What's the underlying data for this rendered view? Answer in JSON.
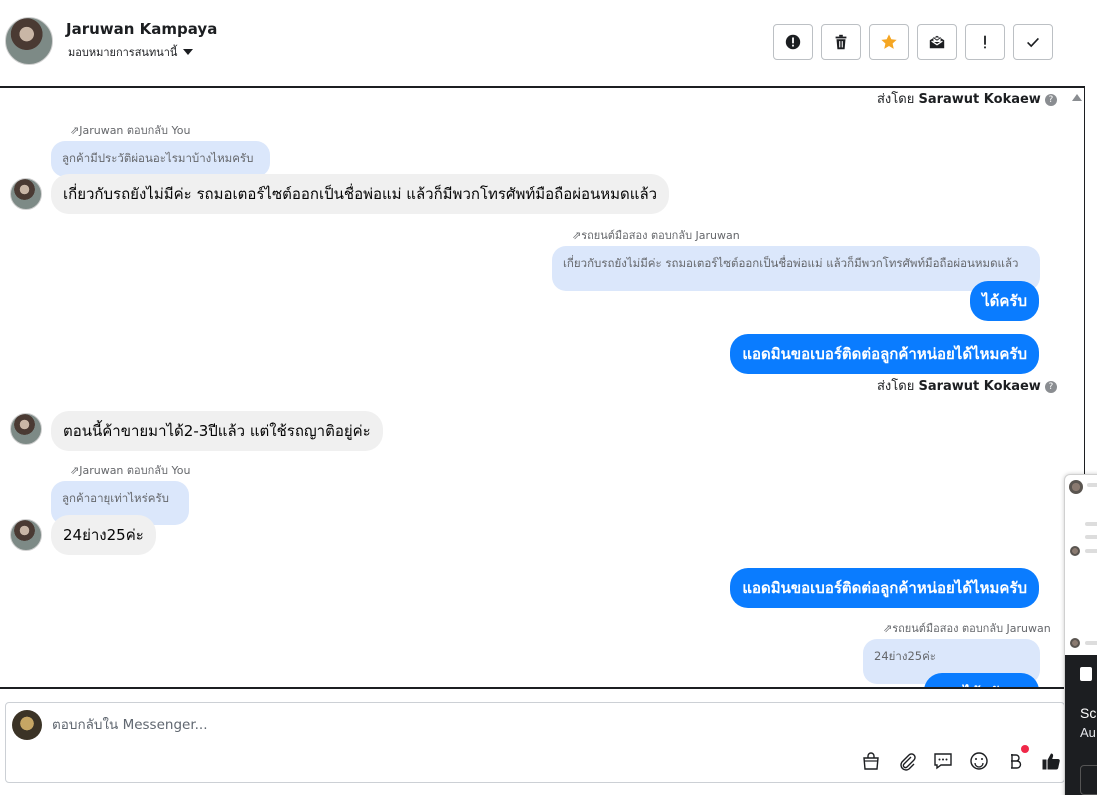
{
  "header": {
    "contact_name": "Jaruwan Kampaya",
    "assign_label": "มอบหมายการสนทนานี้"
  },
  "thread": {
    "sent_by_prefix": "ส่งโดย",
    "sender_name": "Sarawut Kokaew",
    "replies": {
      "r1_header": "Jaruwan ตอบกลับ You",
      "r1_quote": "ลูกค้ามีประวัติผ่อนอะไรมาบ้างไหมครับ",
      "r1_message": "เกี่ยวกับรถยังไม่มีค่ะ รถมอเตอร์ไซต์ออกเป็นชื่อพ่อแม่ แล้วก็มีพวกโทรศัพท์มือถือผ่อนหมดแล้ว",
      "r2_header": "รถยนต์มือสอง ตอบกลับ Jaruwan",
      "r2_quote": "เกี่ยวกับรถยังไม่มีค่ะ รถมอเตอร์ไซต์ออกเป็นชื่อพ่อแม่ แล้วก็มีพวกโทรศัพท์มือถือผ่อนหมดแล้ว",
      "r2_message": "ได้ครับ",
      "out1": "แอดมินขอเบอร์ติดต่อลูกค้าหน่อยได้ไหมครับ",
      "in1": "ตอนนี้ค้าขายมาได้2-3ปีแล้ว แต่ใช้รถญาติอยู่ค่ะ",
      "r3_header": "Jaruwan ตอบกลับ You",
      "r3_quote": "ลูกค้าอายุเท่าไหร่ครับ",
      "r3_message": "24ย่าง25ค่ะ",
      "out2": "แอดมินขอเบอร์ติดต่อลูกค้าหน่อยได้ไหมครับ",
      "r4_header": "รถยนต์มือสอง ตอบกลับ Jaruwan",
      "r4_quote": "24ย่าง25ค่ะ",
      "r4_message": "ออกได้ครับผม"
    }
  },
  "composer": {
    "placeholder": "ตอบกลับใน Messenger..."
  },
  "popup": {
    "line1": "Scr",
    "line2": "Au"
  },
  "icons": {
    "toolbar": [
      "alert-circle-icon",
      "trash-icon",
      "star-icon",
      "mail-icon",
      "exclamation-icon",
      "check-icon"
    ],
    "composer": [
      "shopping-bag-icon",
      "paperclip-icon",
      "chat-bubble-icon",
      "emoji-icon",
      "baht-icon",
      "thumbs-up-icon"
    ]
  },
  "colors": {
    "outgoing_bubble": "#0a7cff",
    "incoming_bubble": "#f0f0f0",
    "quote_bubble": "#dbe7fb",
    "star": "#f5a623",
    "notification_dot": "#f02849"
  }
}
